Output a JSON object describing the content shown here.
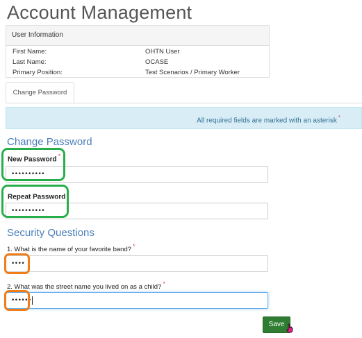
{
  "page": {
    "title": "Account Management"
  },
  "user_info": {
    "heading": "User Information",
    "rows": [
      {
        "label": "First Name:",
        "value": "OHTN User"
      },
      {
        "label": "Last Name:",
        "value": "OCASE"
      },
      {
        "label": "Primary Position:",
        "value": "Test Scenarios / Primary Worker"
      }
    ]
  },
  "tabs": [
    {
      "label": "Change Password",
      "active": true
    }
  ],
  "alert": {
    "text": "All required fields are marked with an asterisk",
    "asterisk": "*"
  },
  "change_password": {
    "title": "Change Password",
    "new_label": "New Password",
    "new_value": "••••••••••",
    "repeat_label": "Repeat Password",
    "repeat_value": "••••••••••"
  },
  "security": {
    "title": "Security Questions",
    "q1_label": "1. What is the name of your favorite band?",
    "q1_value": "••••",
    "q2_label": "2. What was the street name you lived on as a child?",
    "q2_value": "••••••"
  },
  "asterisk": "*",
  "save_label": "Save",
  "colors": {
    "highlight_green": "#27ae4a",
    "highlight_orange": "#f07c1a",
    "save_button": "#2e7d32",
    "section_title": "#4a7fb8",
    "alert_bg": "#d9edf7"
  }
}
